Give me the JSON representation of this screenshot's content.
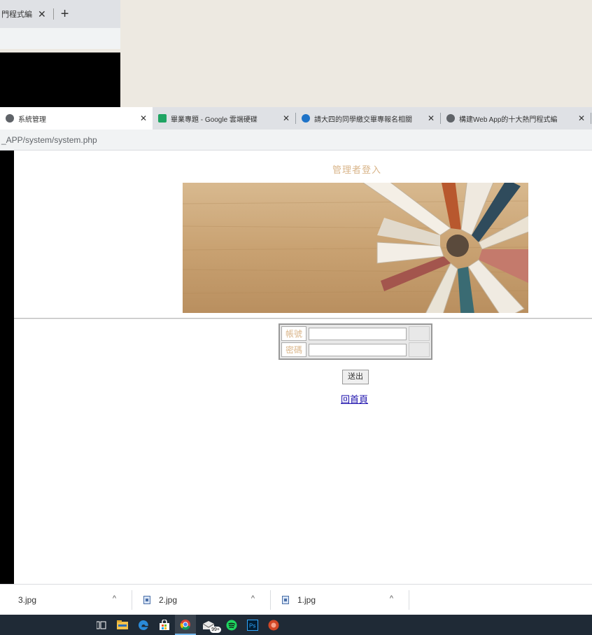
{
  "back_window": {
    "tab_title": "門程式編",
    "tab_close": "✕",
    "new_tab": "+"
  },
  "browser": {
    "tabs": [
      {
        "title": "系統管理",
        "icon": "globe-icon",
        "icon_color": "#5f6368",
        "active": true
      },
      {
        "title": "畢業專題 - Google 雲端硬碟",
        "icon": "google-drive-icon",
        "icon_color": "#1fa463",
        "active": false
      },
      {
        "title": "請大四的同學繳交畢專報名相關",
        "icon": "edge-icon",
        "icon_color": "#1e73c8",
        "active": false
      },
      {
        "title": "構建Web App的十大熱門程式編",
        "icon": "globe-icon",
        "icon_color": "#5f6368",
        "active": false
      }
    ],
    "close_glyph": "✕",
    "url": "_APP/system/system.php"
  },
  "page": {
    "title": "管理者登入",
    "account_label": "帳號",
    "password_label": "密碼",
    "account_value": "",
    "password_value": "",
    "submit_label": "送出",
    "home_link": "回首頁"
  },
  "downloads": [
    {
      "name": "3.jpg"
    },
    {
      "name": "2.jpg"
    },
    {
      "name": "1.jpg"
    }
  ],
  "taskbar": {
    "mail_badge": "99+",
    "icons": [
      "task-view-icon",
      "file-explorer-icon",
      "edge-icon",
      "store-icon",
      "chrome-icon",
      "mail-icon",
      "spotify-icon",
      "photoshop-icon",
      "powerpoint-icon"
    ]
  },
  "colors": {
    "title_accent": "#d9b58a",
    "link": "#1a0dab",
    "taskbar": "#1f2a36"
  }
}
